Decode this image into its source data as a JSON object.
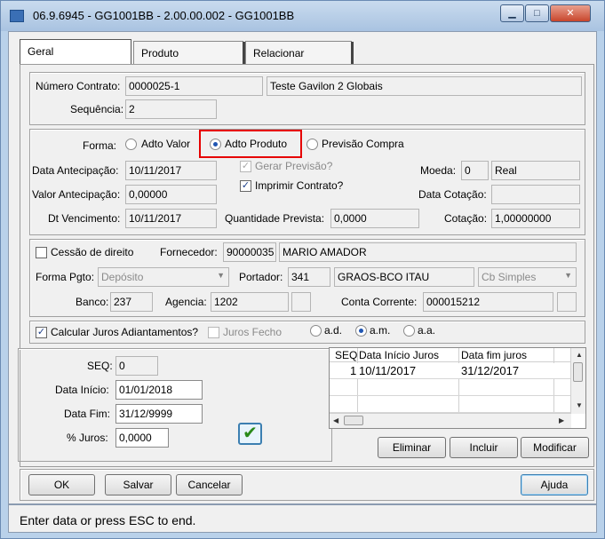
{
  "window": {
    "title": "06.9.6945 - GG1001BB - 2.00.00.002 - GG1001BB"
  },
  "tabs": [
    {
      "label": "Geral"
    },
    {
      "label": "Produto"
    },
    {
      "label": "Relacionar"
    }
  ],
  "contract": {
    "numero_label": "Número Contrato:",
    "numero_value": "0000025-1",
    "descricao_value": "Teste Gavilon 2 Globais",
    "sequencia_label": "Sequência:",
    "sequencia_value": "2"
  },
  "forma": {
    "label": "Forma:",
    "options": [
      {
        "label": "Adto Valor",
        "selected": false
      },
      {
        "label": "Adto Produto",
        "selected": true
      },
      {
        "label": "Previsão Compra",
        "selected": false
      }
    ]
  },
  "antecipacao": {
    "data_label": "Data Antecipação:",
    "data_value": "10/11/2017",
    "valor_label": "Valor Antecipação:",
    "valor_value": "0,00000",
    "vencimento_label": "Dt Vencimento:",
    "vencimento_value": "10/11/2017",
    "gerar_previsao_label": "Gerar Previsão?",
    "gerar_previsao_checked": true,
    "imprimir_label": "Imprimir Contrato?",
    "imprimir_checked": true,
    "qtd_label": "Quantidade Prevista:",
    "qtd_value": "0,0000",
    "moeda_label": "Moeda:",
    "moeda_code": "0",
    "moeda_name": "Real",
    "data_cotacao_label": "Data Cotação:",
    "data_cotacao_value": "",
    "cotacao_label": "Cotação:",
    "cotacao_value": "1,00000000"
  },
  "fornecedor": {
    "cessao_label": "Cessão de direito",
    "cessao_checked": false,
    "fornecedor_label": "Fornecedor:",
    "fornecedor_code": "90000035",
    "fornecedor_name": "MARIO AMADOR",
    "forma_pgto_label": "Forma Pgto:",
    "forma_pgto_value": "Depósito",
    "portador_label": "Portador:",
    "portador_code": "341",
    "portador_name": "GRAOS-BCO ITAU",
    "carteira_value": "Cb Simples",
    "banco_label": "Banco:",
    "banco_value": "237",
    "agencia_label": "Agencia:",
    "agencia_value": "1202",
    "agencia_dv": "",
    "conta_label": "Conta Corrente:",
    "conta_value": "000015212",
    "conta_dv": ""
  },
  "juros": {
    "calcular_label": "Calcular Juros Adiantamentos?",
    "calcular_checked": true,
    "fecho_label": "Juros Fecho",
    "fecho_checked": false,
    "periodo_options": [
      {
        "label": "a.d.",
        "selected": false
      },
      {
        "label": "a.m.",
        "selected": true
      },
      {
        "label": "a.a.",
        "selected": false
      }
    ],
    "seq_label": "SEQ:",
    "seq_value": "0",
    "inicio_label": "Data Início:",
    "inicio_value": "01/01/2018",
    "fim_label": "Data Fim:",
    "fim_value": "31/12/9999",
    "perc_label": "% Juros:",
    "perc_value": "0,0000",
    "table": {
      "columns": [
        "SEQ",
        "Data Início Juros",
        "Data fim juros"
      ],
      "rows": [
        {
          "seq": "1",
          "inicio": "10/11/2017",
          "fim": "31/12/2017"
        }
      ]
    },
    "eliminar_label": "Eliminar",
    "incluir_label": "Incluir",
    "modificar_label": "Modificar"
  },
  "footer": {
    "ok_label": "OK",
    "salvar_label": "Salvar",
    "cancelar_label": "Cancelar",
    "ajuda_label": "Ajuda"
  },
  "status": {
    "text": "Enter data or press ESC to end."
  },
  "icons": {
    "app": "app-icon",
    "confirm": "checkmark-icon",
    "minimize": "minimize-icon",
    "maximize": "maximize-icon",
    "close": "close-icon"
  },
  "colors": {
    "highlight": "#e60000",
    "confirm_check": "#2a8a1a"
  }
}
